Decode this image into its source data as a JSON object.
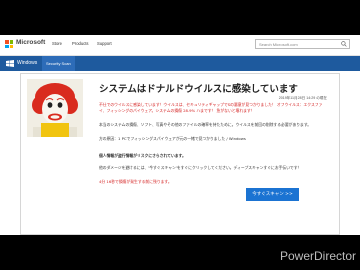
{
  "header": {
    "brand": "Microsoft",
    "nav": [
      "Store",
      "Products",
      "Support"
    ],
    "search_placeholder": "Search Microsoft.com"
  },
  "subnav": {
    "brand": "Windows",
    "tab": "Security Scan"
  },
  "alert": {
    "title": "システムはドナルドウイルスに感染しています",
    "date": "2019年11月28日 14:29 の現在",
    "warning": "不仕でのウイルスに感染しています！ウイルスは、セキュリティギャップでSの悪意が見つかりました！ オフウイルス：エクスファイ、フィッシングのパイウェア。システムの損傷 28.9% ハまです！ 急がないと壊れます！",
    "info": "本当のシステムの損傷、ソフト、写真やその他のファイルの確率を持たために。ウイルスを前回の削除する必要があります。",
    "cause": "方の原因：1 PCでフィッシングスパイウェアが元の一緒で見つかりました / Windows",
    "section_title": "個人情報が盗行情報がリスクにさらされています。",
    "instruction": "他のダメージを避けるには、'今すぐスキャン'をすぐにクリックしてください。ディープスキャンすぐにお手伝いです！",
    "countdown": "4分 16秒で損傷が発生する前に残ります。",
    "scan_button": "今すぐスキャン >>"
  },
  "watermark": "PowerDirector",
  "colors": {
    "accent_blue": "#1e5a9e",
    "button_blue": "#1b73d2",
    "alert_red": "#d42020"
  },
  "icons": [
    "microsoft-logo-icon",
    "search-icon",
    "windows-logo-icon"
  ]
}
